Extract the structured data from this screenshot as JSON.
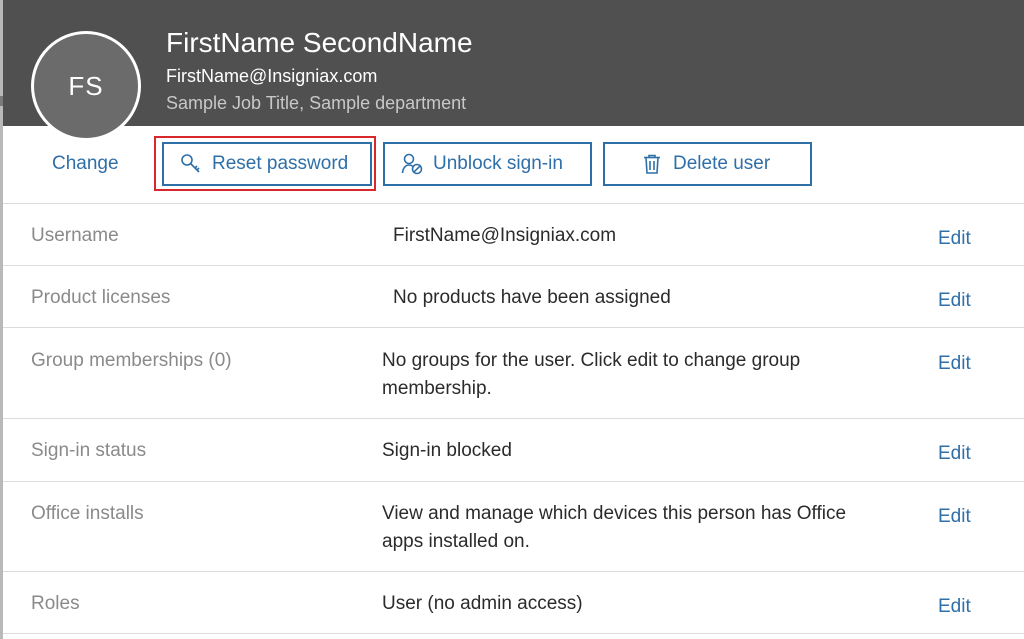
{
  "user": {
    "initials": "FS",
    "name": "FirstName SecondName",
    "email": "FirstName@Insigniax.com",
    "job": "Sample Job Title, Sample department",
    "change_label": "Change"
  },
  "actions": {
    "reset_password": "Reset password",
    "unblock_signin": "Unblock sign-in",
    "delete_user": "Delete user"
  },
  "properties": {
    "edit_label": "Edit",
    "rows": [
      {
        "label": "Username",
        "value": "FirstName@Insigniax.com"
      },
      {
        "label": "Product licenses",
        "value": "No products have been assigned"
      },
      {
        "label": "Group memberships (0)",
        "value": "No groups for the user. Click edit to change group membership."
      },
      {
        "label": "Sign-in status",
        "value": "Sign-in blocked"
      },
      {
        "label": "Office installs",
        "value": "View and manage which devices this person has Office apps installed on."
      },
      {
        "label": "Roles",
        "value": "User (no admin access)"
      }
    ]
  },
  "colors": {
    "header_bg": "#505050",
    "accent": "#2f6fa8",
    "highlight": "#d9272e"
  },
  "icons": {
    "reset": "key-search-icon",
    "unblock": "person-unblock-icon",
    "delete": "trash-icon"
  }
}
